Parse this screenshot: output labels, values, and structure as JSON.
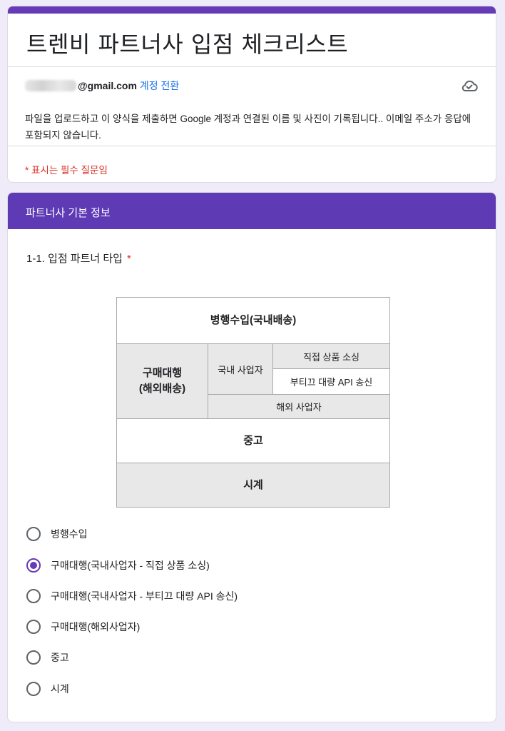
{
  "form": {
    "title": "트렌비 파트너사 입점 체크리스트",
    "email_domain": "@gmail.com",
    "switch_account": "계정 전환",
    "notice": "파일을 업로드하고 이 양식을 제출하면 Google 계정과 연결된 이름 및 사진이 기록됩니다.. 이메일 주소가 응답에 포함되지 않습니다.",
    "required_note": "* 표시는 필수 질문임",
    "icons": {
      "cloud": "cloud-saved-icon"
    }
  },
  "section": {
    "title": "파트너사 기본 정보"
  },
  "question": {
    "title": "1-1. 입점 파트너 타입",
    "required_mark": "*",
    "diagram": {
      "parallel_import": "병행수입(국내배송)",
      "buying_agent_line1": "구매대행",
      "buying_agent_line2": "(해외배송)",
      "domestic_business": "국내 사업자",
      "direct_sourcing": "직접 상품 소싱",
      "api_sending": "부티끄 대량 API 송신",
      "overseas_business": "해외 사업자",
      "used": "중고",
      "watch": "시계"
    },
    "options": [
      {
        "label": "병행수입",
        "selected": false
      },
      {
        "label": "구매대행(국내사업자 - 직접 상품 소싱)",
        "selected": true
      },
      {
        "label": "구매대행(국내사업자 - 부티끄 대량 API 송신)",
        "selected": false
      },
      {
        "label": "구매대행(해외사업자)",
        "selected": false
      },
      {
        "label": "중고",
        "selected": false
      },
      {
        "label": "시계",
        "selected": false
      }
    ]
  },
  "colors": {
    "accent": "#673ab7",
    "section_header": "#5e3bb5",
    "background": "#f0ebf8",
    "required": "#d93025",
    "link": "#1a73e8"
  }
}
